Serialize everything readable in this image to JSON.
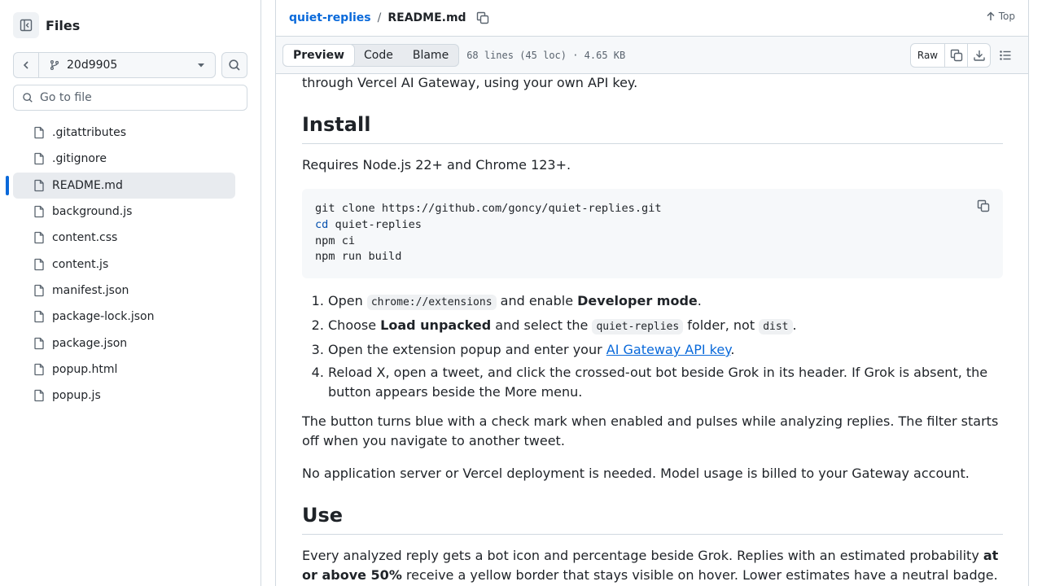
{
  "sidebar": {
    "title": "Files",
    "branch": "20d9905",
    "goto_placeholder": "Go to file",
    "files": [
      {
        "name": ".gitattributes",
        "active": false
      },
      {
        "name": ".gitignore",
        "active": false
      },
      {
        "name": "README.md",
        "active": true
      },
      {
        "name": "background.js",
        "active": false
      },
      {
        "name": "content.css",
        "active": false
      },
      {
        "name": "content.js",
        "active": false
      },
      {
        "name": "manifest.json",
        "active": false
      },
      {
        "name": "package-lock.json",
        "active": false
      },
      {
        "name": "package.json",
        "active": false
      },
      {
        "name": "popup.html",
        "active": false
      },
      {
        "name": "popup.js",
        "active": false
      }
    ]
  },
  "header": {
    "repo": "quiet-replies",
    "separator": "/",
    "file": "README.md",
    "top_label": "Top"
  },
  "toolbar": {
    "tabs": [
      "Preview",
      "Code",
      "Blame"
    ],
    "active_tab": "Preview",
    "file_info": "68 lines (45 loc) · 4.65 KB",
    "raw_label": "Raw"
  },
  "readme": {
    "intro_tail": "through Vercel AI Gateway, using your own API key.",
    "install_heading": "Install",
    "requires": "Requires Node.js 22+ and Chrome 123+.",
    "code_lines": [
      {
        "kw": "",
        "text": "git clone https://github.com/goncy/quiet-replies.git"
      },
      {
        "kw": "cd",
        "text": " quiet-replies"
      },
      {
        "kw": "",
        "text": "npm ci"
      },
      {
        "kw": "",
        "text": "npm run build"
      }
    ],
    "steps": {
      "s1_a": "Open ",
      "s1_code": "chrome://extensions",
      "s1_b": " and enable ",
      "s1_bold": "Developer mode",
      "s1_c": ".",
      "s2_a": "Choose ",
      "s2_bold": "Load unpacked",
      "s2_b": " and select the ",
      "s2_code1": "quiet-replies",
      "s2_c": " folder, not ",
      "s2_code2": "dist",
      "s2_d": ".",
      "s3_a": "Open the extension popup and enter your ",
      "s3_link": "AI Gateway API key",
      "s3_b": ".",
      "s4": "Reload X, open a tweet, and click the crossed-out bot beside Grok in its header. If Grok is absent, the button appears beside the More menu."
    },
    "para_button": "The button turns blue with a check mark when enabled and pulses while analyzing replies. The filter starts off when you navigate to another tweet.",
    "para_server": "No application server or Vercel deployment is needed. Model usage is billed to your Gateway account.",
    "use_heading": "Use",
    "use_a": "Every analyzed reply gets a bot icon and percentage beside Grok. Replies with an estimated probability ",
    "use_bold": "at or above 50%",
    "use_b": " receive a yellow border that stays visible on hover. Lower estimates have a neutral badge."
  }
}
